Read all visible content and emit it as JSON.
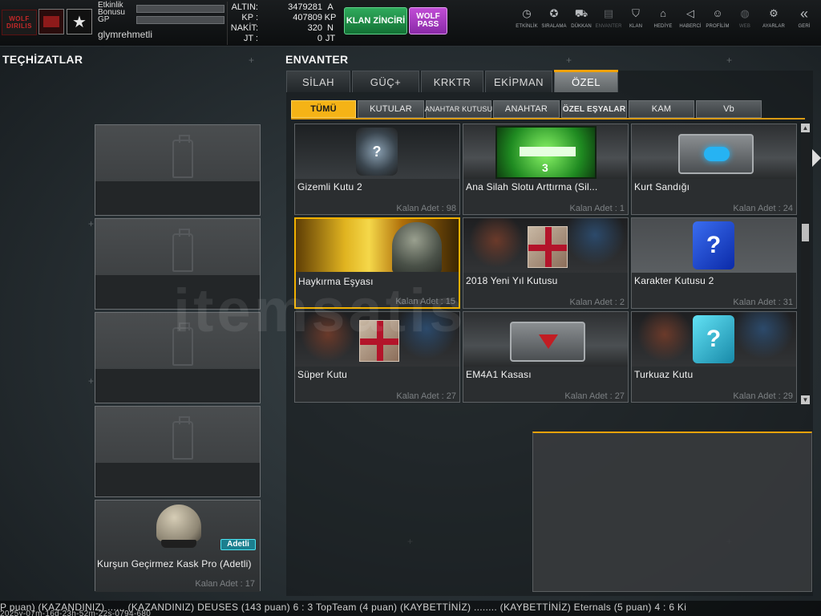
{
  "player": {
    "logo_text": "WOLF",
    "logo_subtext": "DIRILIS",
    "bonus_label": "Etkinlik Bonusu",
    "gp_label": "GP",
    "username": "glymrehmetli"
  },
  "currency": [
    {
      "label": "ALTIN:",
      "value": "3479281",
      "unit": "A"
    },
    {
      "label": "KP :",
      "value": "407809",
      "unit": "KP"
    },
    {
      "label": "NAKİT:",
      "value": "320",
      "unit": "N"
    },
    {
      "label": "JT :",
      "value": "0",
      "unit": "JT"
    }
  ],
  "buttons": {
    "klan_zinciri": "KLAN ZİNCİRİ",
    "wolf_pass": "WOLF PASS"
  },
  "nav": [
    {
      "label": "ETKİNLİK",
      "icon": "clock-icon"
    },
    {
      "label": "SIRALAMA",
      "icon": "medal-icon"
    },
    {
      "label": "DÜKKAN",
      "icon": "cart-icon"
    },
    {
      "label": "ENVANTER",
      "icon": "inventory-icon"
    },
    {
      "label": "KLAN",
      "icon": "shield-icon"
    },
    {
      "label": "HEDİYE",
      "icon": "gift-icon"
    },
    {
      "label": "HABERCİ",
      "icon": "megaphone-icon"
    },
    {
      "label": "PROFİLİM",
      "icon": "profile-icon"
    },
    {
      "label": "WEB",
      "icon": "globe-icon"
    },
    {
      "label": "AYARLAR",
      "icon": "gear-icon"
    },
    {
      "label": "GERİ",
      "icon": "back-icon"
    }
  ],
  "sections": {
    "equipment_title": "TEÇHİZATLAR",
    "inventory_title": "ENVANTER"
  },
  "equipment": {
    "filled_item_name": "Kurşun Geçirmez Kask Pro (Adetli)",
    "filled_item_tag": "Adetli",
    "filled_item_count": "Kalan Adet : 17"
  },
  "tabs": [
    "SİLAH",
    "GÜÇ+",
    "KRKTR",
    "EKİPMAN",
    "ÖZEL"
  ],
  "active_tab": "ÖZEL",
  "subtabs": [
    "TÜMÜ",
    "KUTULAR",
    "ANAHTAR KUTUSU",
    "ANAHTAR",
    "ÖZEL EŞYALAR",
    "KAM",
    "Vb"
  ],
  "active_subtab": "TÜMÜ",
  "items": [
    {
      "name": "Gizemli Kutu 2",
      "count": "Kalan Adet : 98"
    },
    {
      "name": "Ana Silah Slotu Arttırma (Sil...",
      "count": "Kalan Adet : 1"
    },
    {
      "name": "Kurt Sandığı",
      "count": "Kalan Adet : 24"
    },
    {
      "name": "Haykırma Eşyası",
      "count": "Kalan Adet : 15"
    },
    {
      "name": "2018 Yeni Yıl Kutusu",
      "count": "Kalan Adet : 2"
    },
    {
      "name": "Karakter Kutusu 2",
      "count": "Kalan Adet : 31"
    },
    {
      "name": "Süper Kutu",
      "count": "Kalan Adet : 27"
    },
    {
      "name": "EM4A1 Kasası",
      "count": "Kalan Adet : 27"
    },
    {
      "name": "Turkuaz Kutu",
      "count": "Kalan Adet : 29"
    }
  ],
  "item_images": {
    "gun_slot_number": "3",
    "question_mark": "?"
  },
  "ticker": {
    "text": "P puan) (KAZANDINIZ) ...... (KAZANDINIZ) DEUSES (143 puan) 6 : 3 TopTeam (4 puan) (KAYBETTİNİZ) ........ (KAYBETTİNİZ) Eternals (5 puan) 4 : 6 Ki",
    "timestamp": "2025y-07m-16d-23h-52m-22s-0794-680"
  },
  "watermark": "itemsatis",
  "colors": {
    "accent": "#f0a20a",
    "active_subtab": "#f5b316",
    "klan_button": "#1f8f45",
    "wolf_pass": "#a63bbf"
  }
}
